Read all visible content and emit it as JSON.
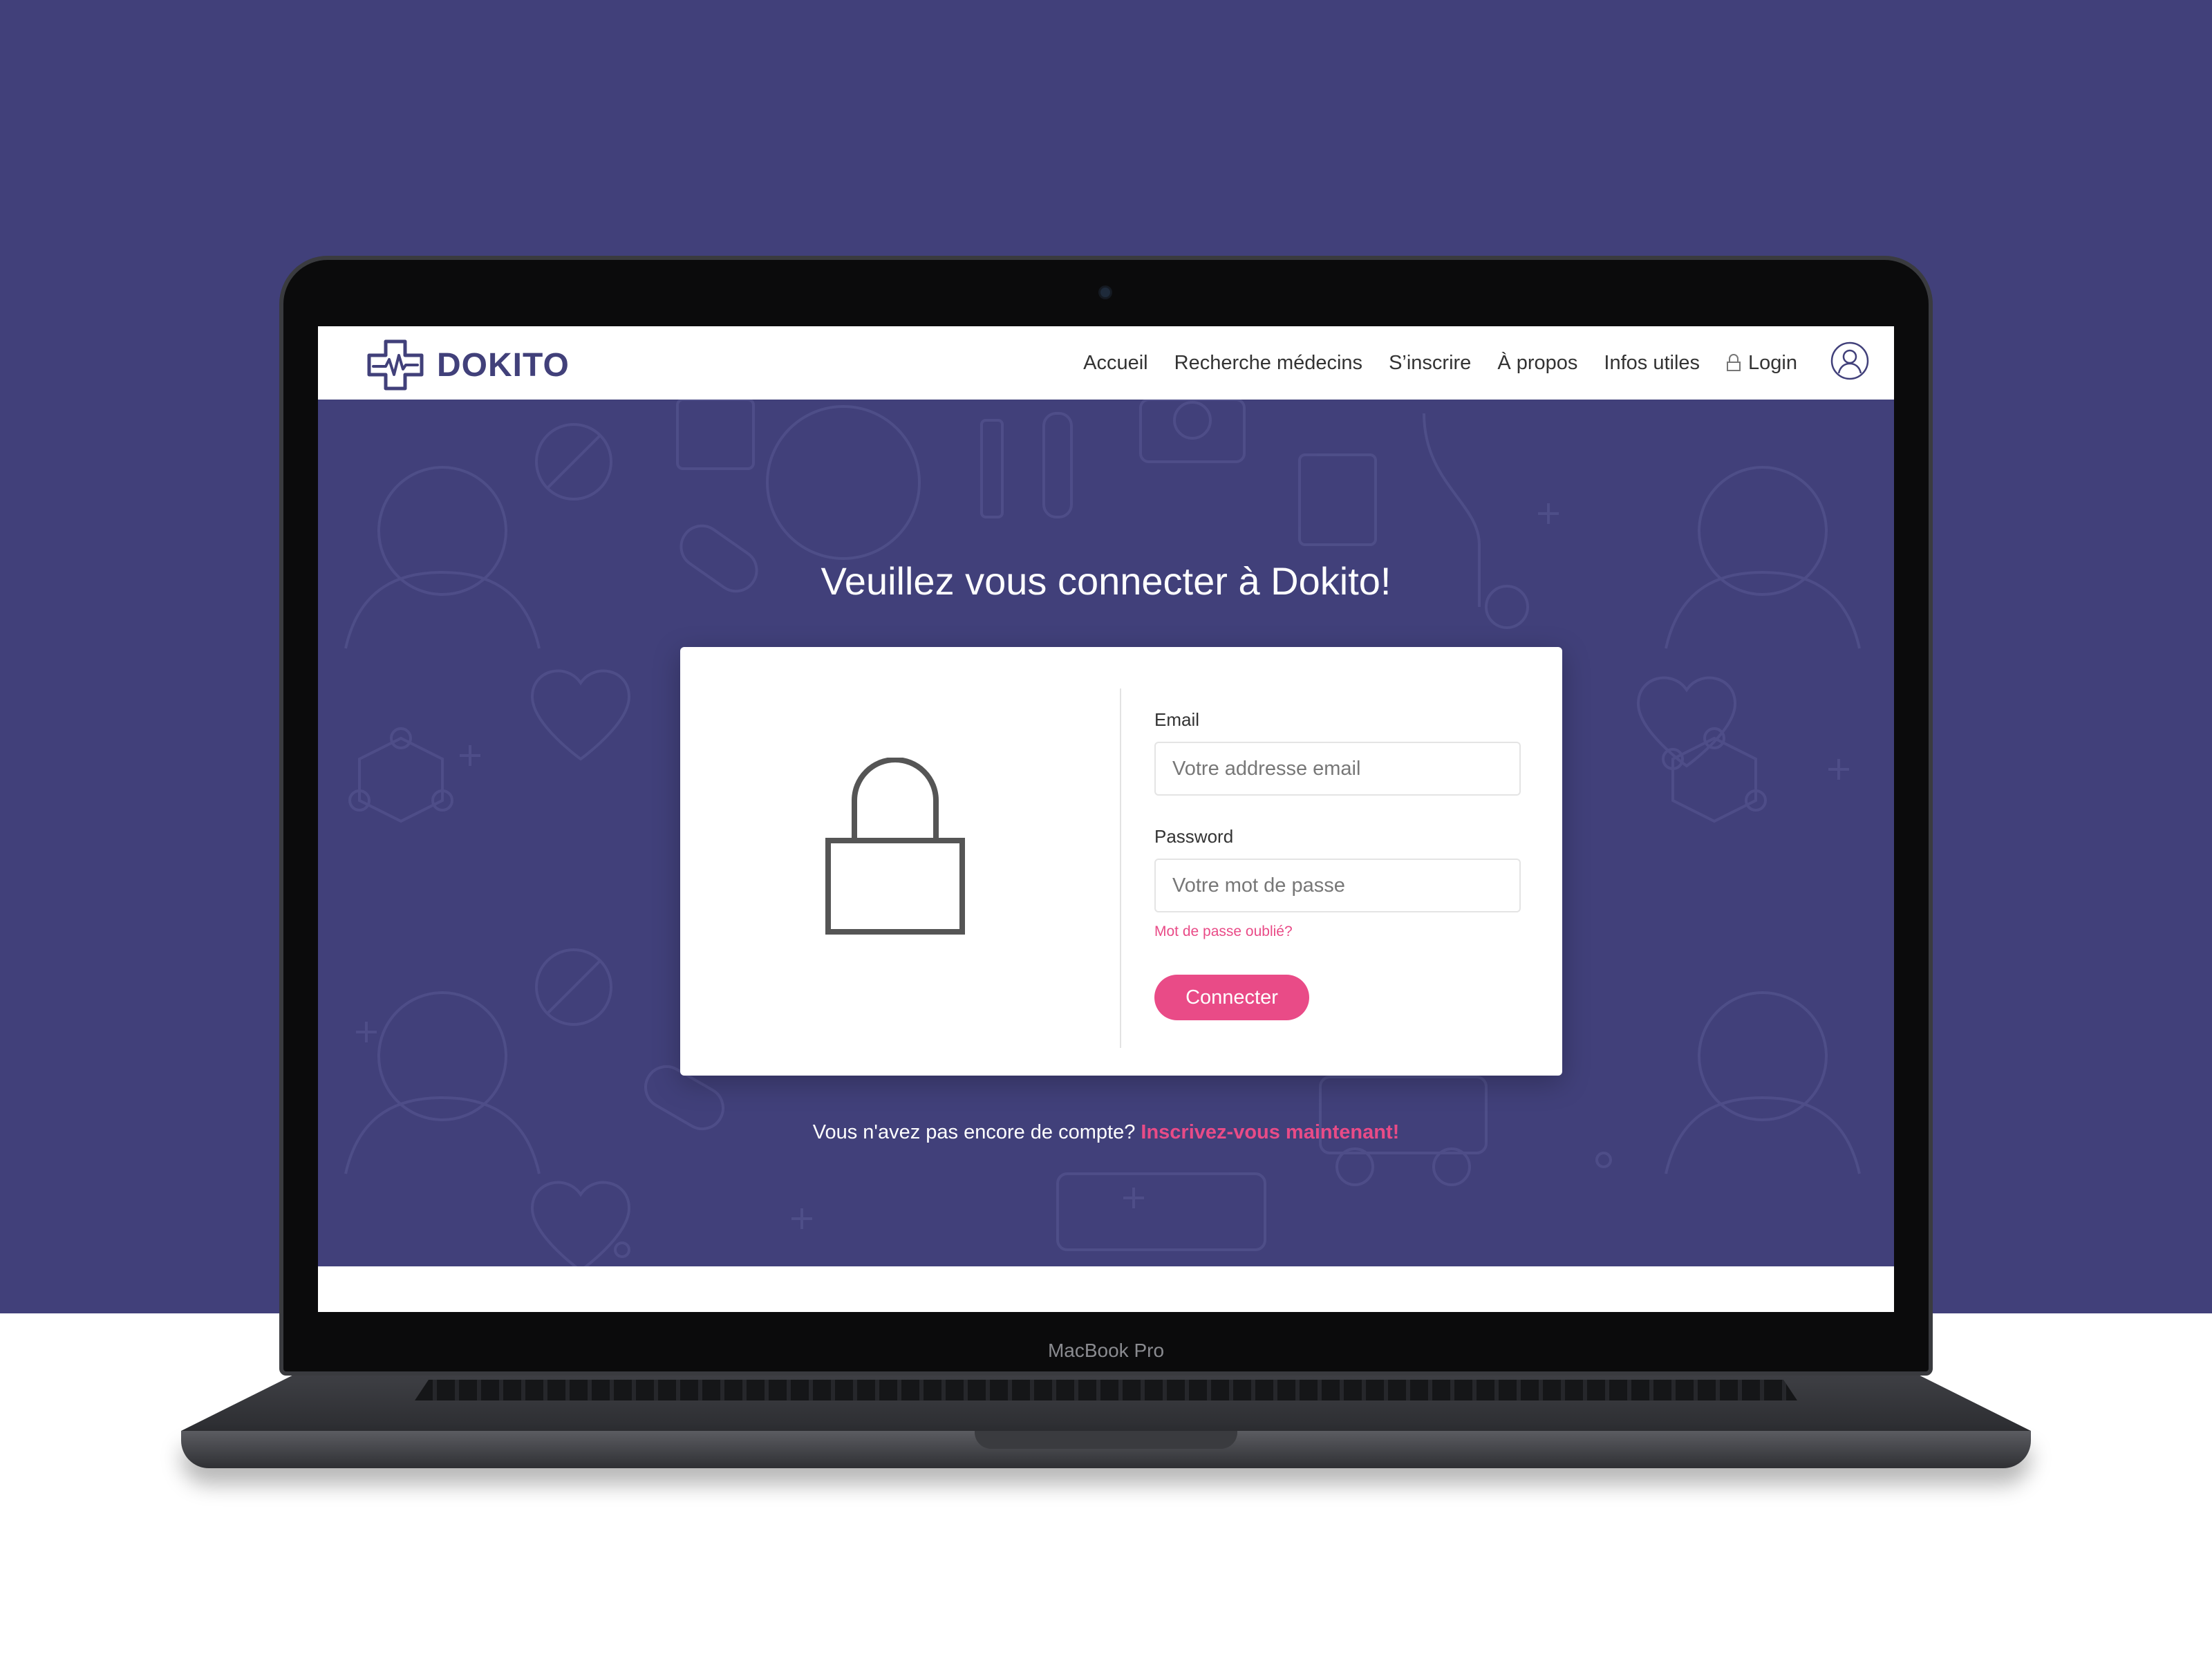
{
  "device": {
    "label": "MacBook Pro"
  },
  "site": {
    "brand": "DOKITO",
    "nav": [
      {
        "label": "Accueil"
      },
      {
        "label": "Recherche médecins"
      },
      {
        "label": "S’inscrire"
      },
      {
        "label": "À propos"
      },
      {
        "label": "Infos utiles"
      }
    ],
    "login_label": "Login"
  },
  "login": {
    "title": "Veuillez vous connecter à Dokito!",
    "email_label": "Email",
    "email_placeholder": "Votre addresse email",
    "password_label": "Password",
    "password_placeholder": "Votre mot de passe",
    "forgot_label": "Mot de passe oublié?",
    "submit_label": "Connecter",
    "signup_prompt": "Vous n'avez pas encore de compte?",
    "signup_link": "Inscrivez-vous maintenant!"
  },
  "colors": {
    "brand_purple": "#41407a",
    "accent_pink": "#e94b87"
  },
  "icons": {
    "logo": "medical-cross-heartbeat-icon",
    "login": "lock-icon",
    "user": "user-avatar-icon",
    "card": "padlock-icon"
  }
}
